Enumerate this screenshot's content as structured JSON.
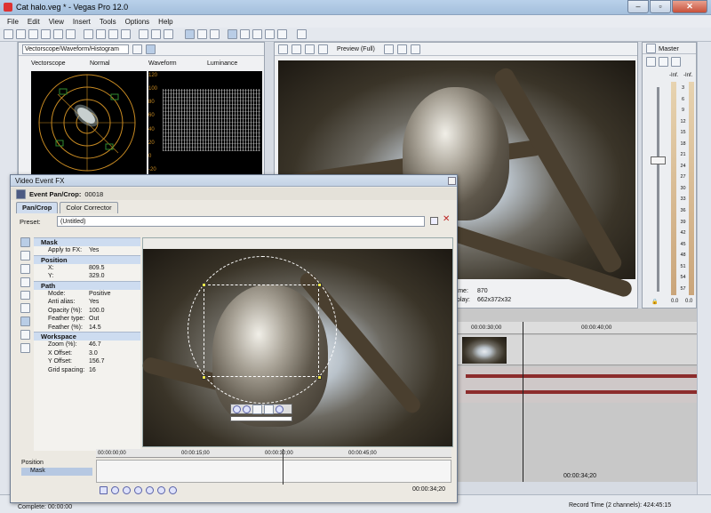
{
  "app": {
    "title": "Cat halo.veg * - Vegas Pro 12.0",
    "win_min": "–",
    "win_max": "▫",
    "win_close": "✕"
  },
  "menu": [
    "File",
    "Edit",
    "View",
    "Insert",
    "Tools",
    "Options",
    "Help"
  ],
  "scopes": {
    "dropdown": "Vectorscope/Waveform/Histogram",
    "vectorscope_label": "Vectorscope",
    "vectorscope_mode": "Normal",
    "waveform_label": "Waveform",
    "waveform_mode": "Luminance",
    "waveform_ticks": [
      "120",
      "100",
      "80",
      "60",
      "40",
      "20",
      "0",
      "-20"
    ]
  },
  "preview": {
    "quality": "Preview (Full)",
    "frame_label": "rame:",
    "frame_value": "870",
    "display_label": "isplay:",
    "display_value": "662x372x32"
  },
  "master": {
    "title": "Master",
    "db_left": "-Inf.",
    "db_right": "-Inf.",
    "scale": [
      "3",
      "6",
      "9",
      "12",
      "15",
      "18",
      "21",
      "24",
      "27",
      "30",
      "33",
      "36",
      "39",
      "42",
      "45",
      "48",
      "51",
      "54",
      "57"
    ],
    "readout_left": "0.0",
    "readout_right": "0.0"
  },
  "timeline": {
    "ruler": [
      "00:00:30;00",
      "00:00:40;00"
    ],
    "cursor_time": "00:00:34;20"
  },
  "status": {
    "left": "Complete: 00:00:00",
    "record_time": "Record Time (2 channels): 424:45:15"
  },
  "fx_dialog": {
    "title": "Video Event FX",
    "header_label": "Event Pan/Crop:",
    "header_value": "00018",
    "tabs": [
      "Pan/Crop",
      "Color Corrector"
    ],
    "preset_label": "Preset:",
    "preset_value": "(Untitled)",
    "sections": {
      "mask": {
        "title": "Mask",
        "rows": [
          {
            "k": "Apply to FX:",
            "v": "Yes"
          }
        ]
      },
      "position": {
        "title": "Position",
        "rows": [
          {
            "k": "X:",
            "v": "809.5"
          },
          {
            "k": "Y:",
            "v": "329.0"
          }
        ]
      },
      "path": {
        "title": "Path",
        "rows": [
          {
            "k": "Mode:",
            "v": "Positive"
          },
          {
            "k": "Anti alias:",
            "v": "Yes"
          },
          {
            "k": "Opacity (%):",
            "v": "100.0"
          },
          {
            "k": "Feather type:",
            "v": "Out"
          },
          {
            "k": "Feather (%):",
            "v": "14.5"
          }
        ]
      },
      "workspace": {
        "title": "Workspace",
        "rows": [
          {
            "k": "Zoom (%):",
            "v": "46.7"
          },
          {
            "k": "X Offset:",
            "v": "3.0"
          },
          {
            "k": "Y Offset:",
            "v": "156.7"
          },
          {
            "k": "Grid spacing:",
            "v": "16"
          }
        ]
      }
    },
    "keyframe_ruler": [
      "00:00:00;00",
      "00:00:15;00",
      "00:00:30;00",
      "00:00:45;00"
    ],
    "tracks": [
      "Position",
      "Mask"
    ],
    "time": "00:00:34;20"
  }
}
